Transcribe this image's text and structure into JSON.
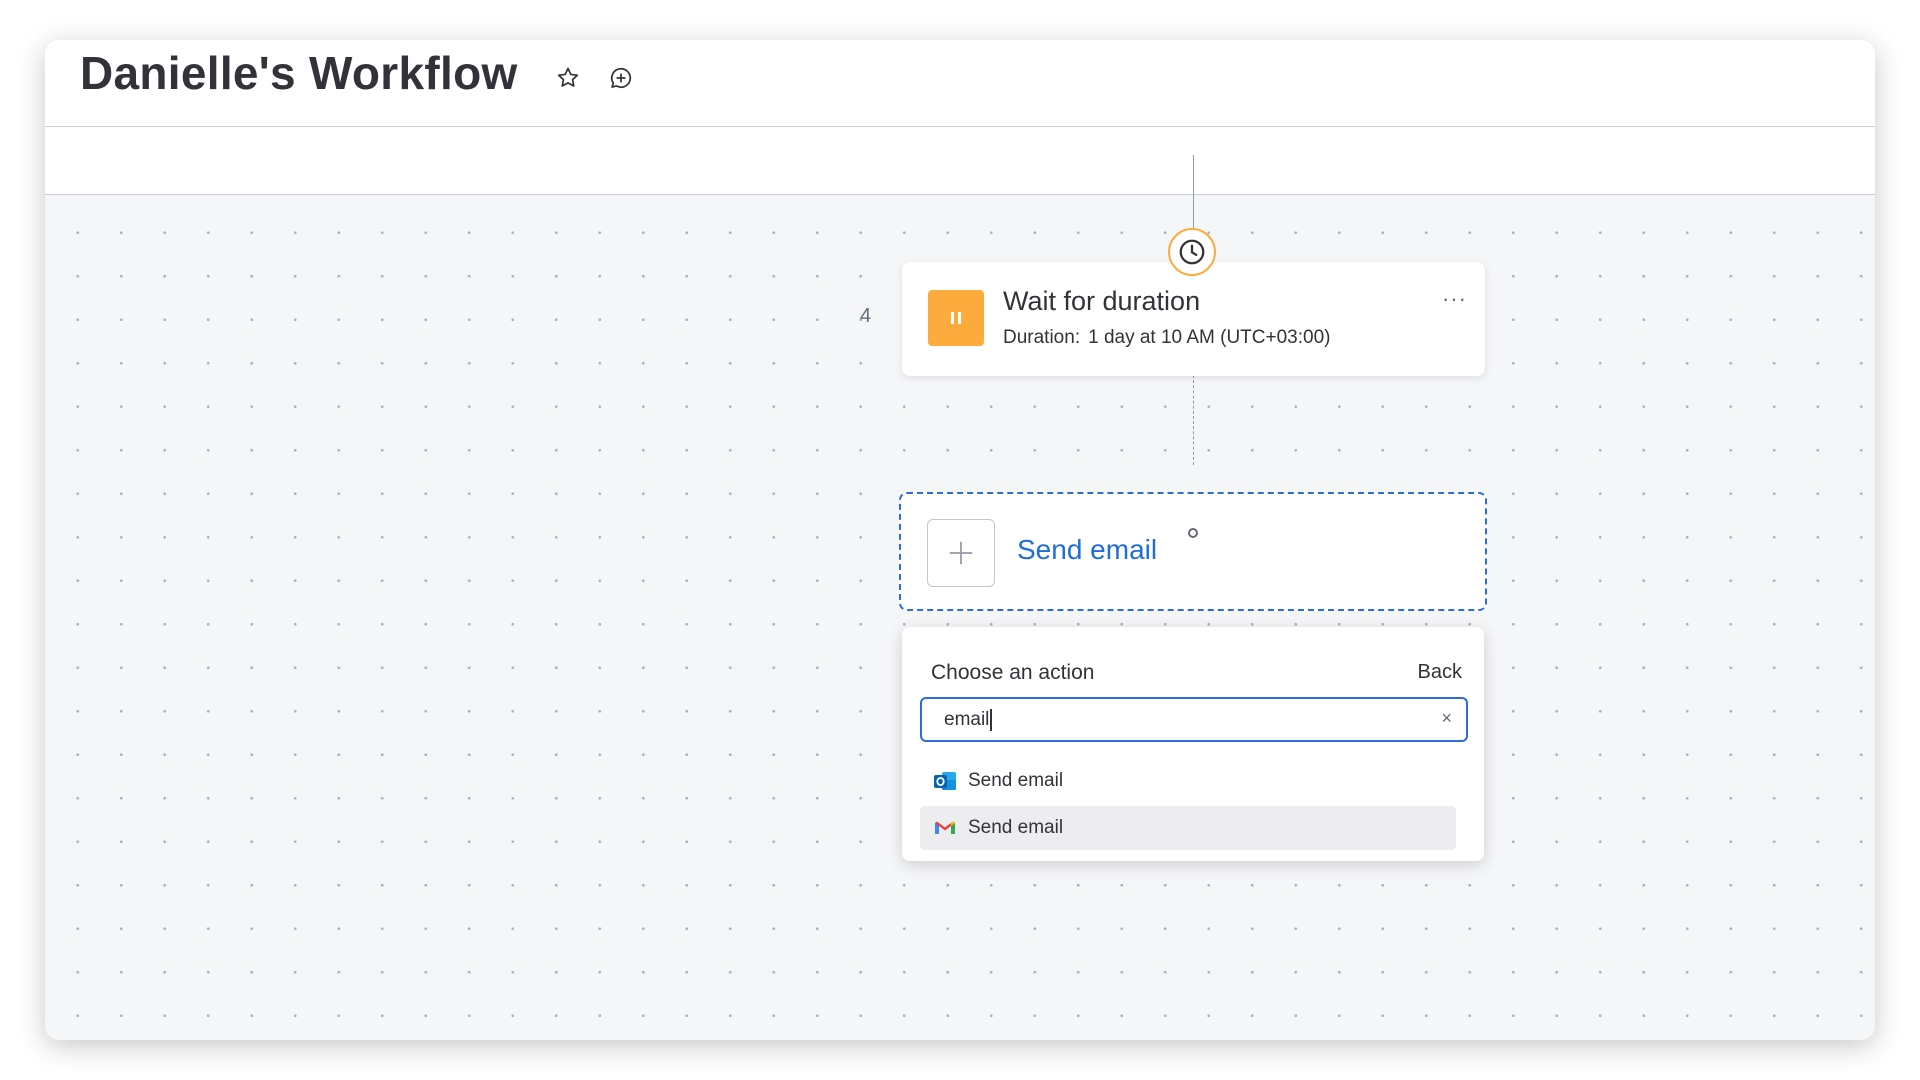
{
  "board": {
    "title": "Danielle's Workflow"
  },
  "header_icons": [
    "star-icon",
    "chat-add-icon"
  ],
  "steps": {
    "wait": {
      "number": "4",
      "title": "Wait for duration",
      "duration_label": "Duration:",
      "duration_value": "1 day at 10 AM (UTC+03:00)",
      "more_label": "···",
      "icon": "pause-icon",
      "badge_icon": "clock-icon",
      "color": "#fdab3d"
    },
    "action": {
      "label": "Send email",
      "icon": "plus-icon",
      "accent": "#2d6be0"
    }
  },
  "dropdown": {
    "title": "Choose an action",
    "back_label": "Back",
    "search_value": "email",
    "clear_label": "×",
    "items": [
      {
        "label": "Send email",
        "icon": "outlook-icon"
      },
      {
        "label": "Send email",
        "icon": "gmail-icon"
      }
    ]
  }
}
